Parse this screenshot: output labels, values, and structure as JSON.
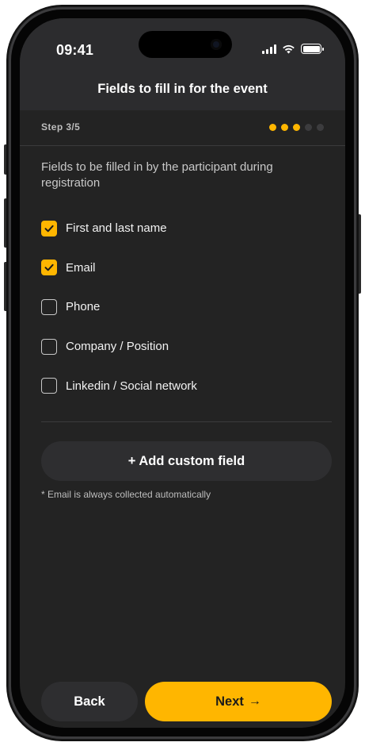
{
  "status_bar": {
    "time": "09:41"
  },
  "header": {
    "title": "Fields to fill in for the event"
  },
  "step": {
    "label": "Step 3/5",
    "current": 3,
    "total": 5
  },
  "intro": "Fields to be filled in by the participant during registration",
  "fields": [
    {
      "label": "First and last name",
      "checked": true
    },
    {
      "label": "Email",
      "checked": true
    },
    {
      "label": "Phone",
      "checked": false
    },
    {
      "label": "Company / Position",
      "checked": false
    },
    {
      "label": "Linkedin / Social network",
      "checked": false
    }
  ],
  "add_custom_field_label": "+ Add custom field",
  "note": "* Email is always collected automatically",
  "footer": {
    "back_label": "Back",
    "next_label": "Next",
    "next_arrow": "→"
  },
  "colors": {
    "accent": "#ffb600",
    "background": "#232323",
    "surface": "#2e2e30"
  }
}
